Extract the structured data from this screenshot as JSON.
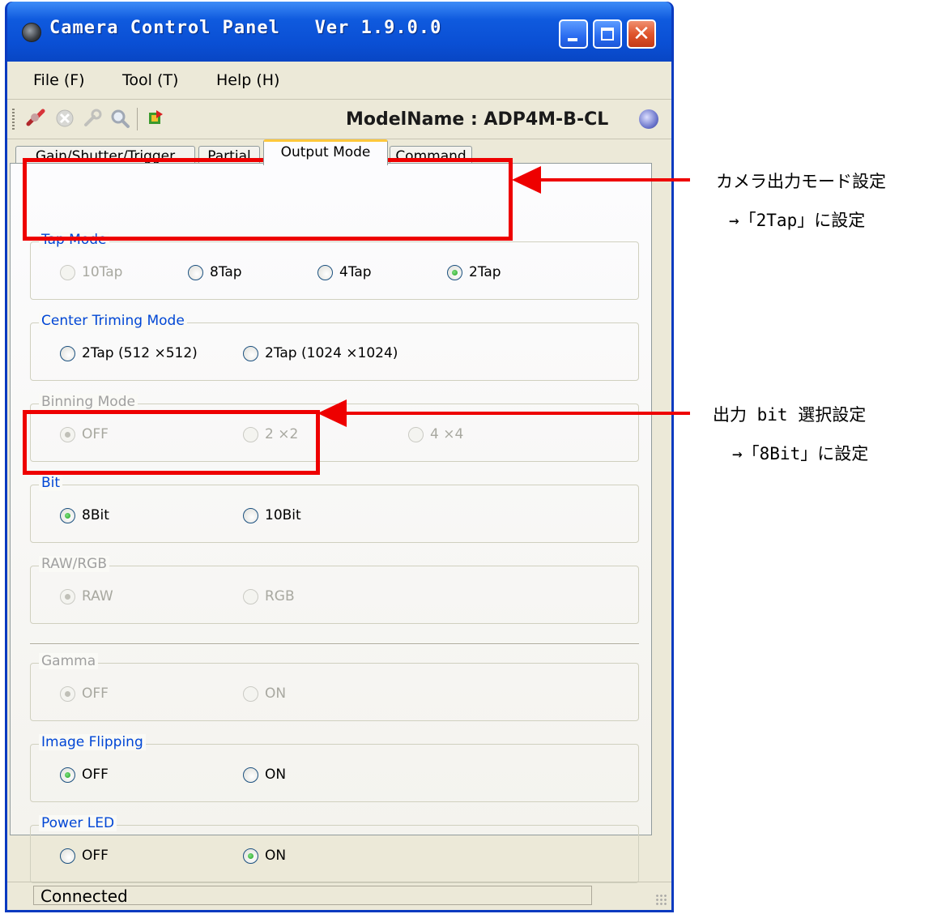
{
  "window": {
    "title": "Camera Control Panel   Ver 1.9.0.0",
    "close_glyph": "✕"
  },
  "menu": [
    "File (F)",
    "Tool (T)",
    "Help (H)"
  ],
  "toolbar": {
    "model_label": "ModelName : ADP4M-B-CL",
    "icons": [
      "connect-icon",
      "disconnect-icon",
      "settings-icon",
      "search-icon",
      "save-icon",
      "info-icon"
    ]
  },
  "tabs": [
    "Gain/Shutter/Trigger",
    "Partial",
    "Output Mode",
    "Command"
  ],
  "active_tab": "Output Mode",
  "groups": [
    {
      "title": "Tap Mode",
      "options": [
        "10Tap",
        "8Tap",
        "4Tap",
        "2Tap"
      ],
      "selected": "2Tap",
      "disabled": [
        "10Tap"
      ]
    },
    {
      "title": "Center Triming Mode",
      "options": [
        "2Tap (512 ×512)",
        "2Tap (1024 ×1024)"
      ],
      "selected": null
    },
    {
      "title": "Binning Mode",
      "options": [
        "OFF",
        "2 ×2",
        "4 ×4"
      ],
      "selected": "OFF",
      "disabled_group": true
    },
    {
      "title": "Bit",
      "options": [
        "8Bit",
        "10Bit"
      ],
      "selected": "8Bit"
    },
    {
      "title": "RAW/RGB",
      "options": [
        "RAW",
        "RGB"
      ],
      "selected": "RAW",
      "disabled_group": true
    },
    {
      "title": "Gamma",
      "options": [
        "OFF",
        "ON"
      ],
      "selected": "OFF",
      "disabled_group": true
    },
    {
      "title": "Image Flipping",
      "options": [
        "OFF",
        "ON"
      ],
      "selected": "OFF"
    },
    {
      "title": "Power LED",
      "options": [
        "OFF",
        "ON"
      ],
      "selected": "ON"
    }
  ],
  "status": "Connected",
  "annotations": [
    {
      "line1": "カメラ出力モード設定",
      "line2": "→「2Tap」に設定"
    },
    {
      "line1": "出力 bit 選択設定",
      "line2": "→「8Bit」に設定"
    }
  ],
  "colors": {
    "highlight": "#ee0000",
    "title_bar": "#0a4fd4",
    "group_title": "#0046d5"
  }
}
